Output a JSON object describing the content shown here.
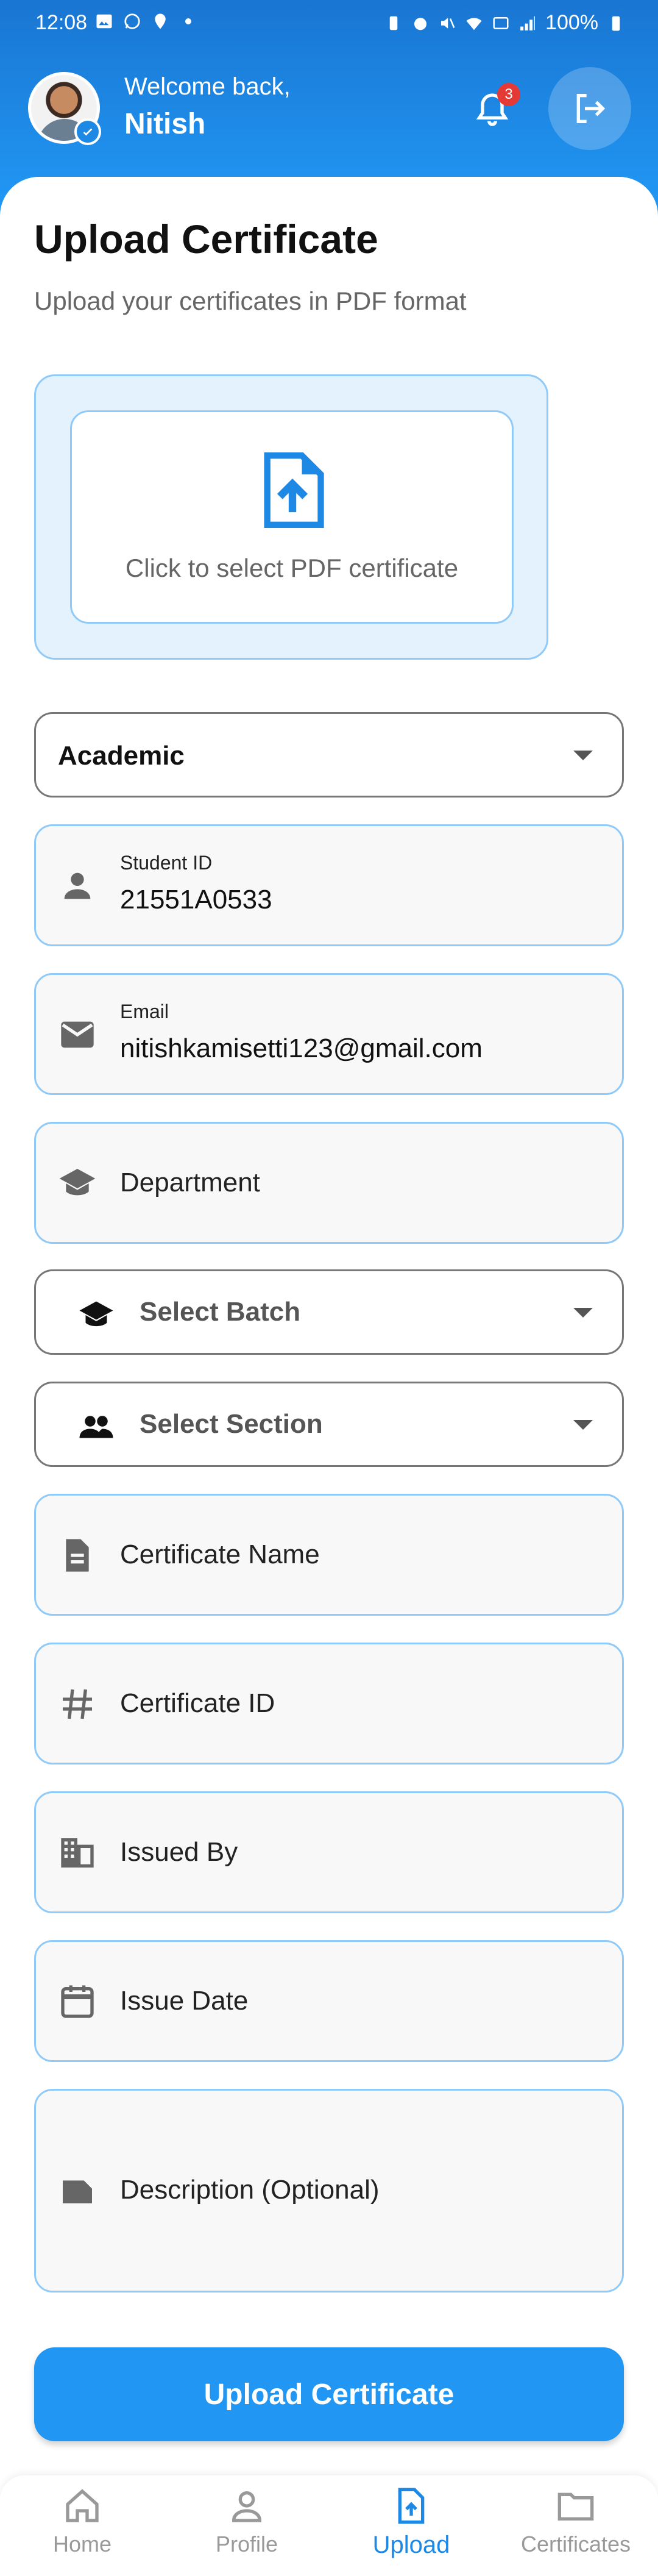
{
  "status_bar": {
    "time": "12:08",
    "battery": "100%"
  },
  "header": {
    "welcome": "Welcome back,",
    "user_name": "Nitish",
    "notification_count": "3"
  },
  "page": {
    "title": "Upload Certificate",
    "subtitle": "Upload your certificates in PDF format"
  },
  "upload_zone": {
    "prompt": "Click to select PDF certificate"
  },
  "form": {
    "category": {
      "value": "Academic"
    },
    "student_id": {
      "label": "Student ID",
      "value": "21551A0533"
    },
    "email": {
      "label": "Email",
      "value": "nitishkamisetti123@gmail.com"
    },
    "department": {
      "placeholder": "Department"
    },
    "batch": {
      "placeholder": "Select Batch"
    },
    "section": {
      "placeholder": "Select Section"
    },
    "certificate_name": {
      "placeholder": "Certificate Name"
    },
    "certificate_id": {
      "placeholder": "Certificate ID"
    },
    "issued_by": {
      "placeholder": "Issued By"
    },
    "issue_date": {
      "placeholder": "Issue Date"
    },
    "description": {
      "placeholder": "Description (Optional)"
    },
    "submit_label": "Upload Certificate"
  },
  "bottom_nav": {
    "items": [
      {
        "label": "Home",
        "icon": "home-icon",
        "active": false
      },
      {
        "label": "Profile",
        "icon": "person-icon",
        "active": false
      },
      {
        "label": "Upload",
        "icon": "upload-file-icon",
        "active": true
      },
      {
        "label": "Certificates",
        "icon": "folder-icon",
        "active": false
      }
    ]
  },
  "colors": {
    "primary": "#2196F3",
    "primary_dark": "#1976D2",
    "field_border": "#90CAF9",
    "upload_bg": "#E3F2FD",
    "badge_red": "#E53935"
  }
}
